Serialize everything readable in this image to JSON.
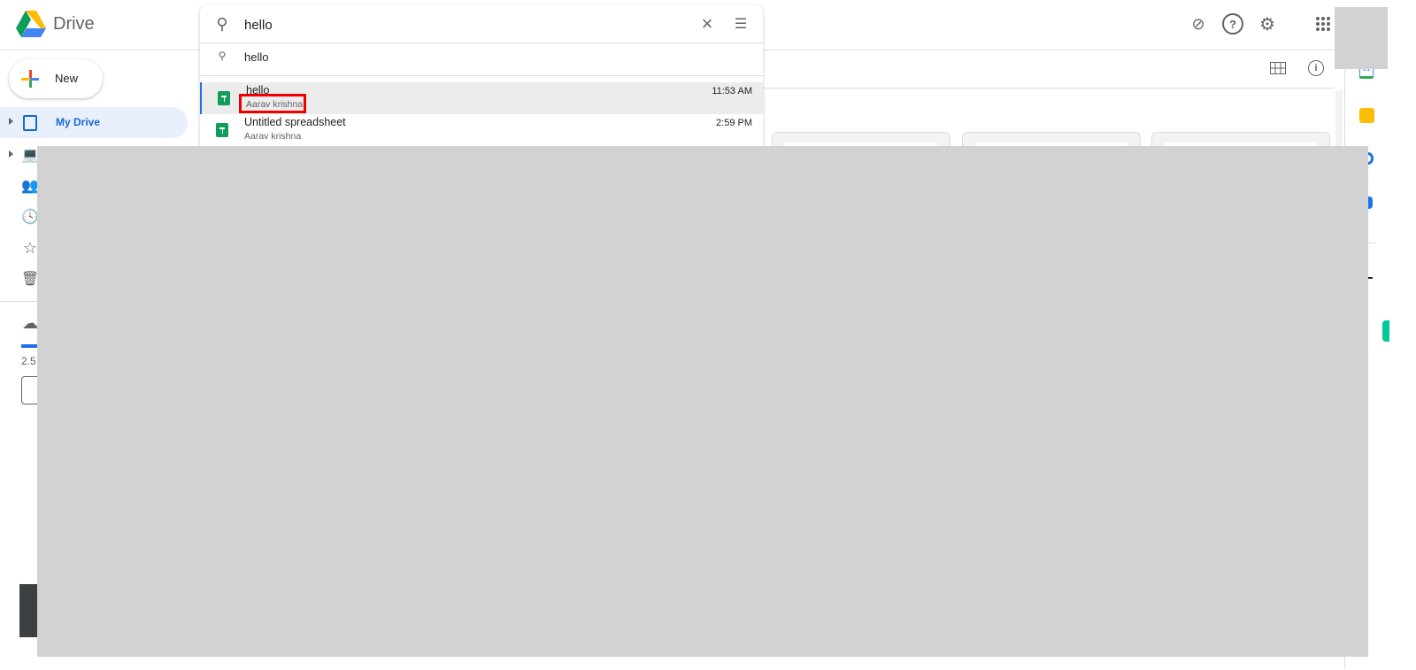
{
  "app": {
    "title": "Drive"
  },
  "sidebar": {
    "new_label": "New",
    "items": [
      {
        "label": "My Drive",
        "active": true
      }
    ],
    "storage_text": "2.5"
  },
  "search": {
    "value": "hello",
    "suggestion": "hello",
    "results": [
      {
        "name": "hello",
        "owner": "Aarav krishna",
        "time": "11:53 AM",
        "type": "spreadsheet",
        "selected": true
      },
      {
        "name": "Untitled spreadsheet",
        "owner": "Aarav krishna",
        "time": "2:59 PM",
        "type": "spreadsheet",
        "selected": false
      }
    ]
  },
  "colors": {
    "accent": "#1967d2",
    "highlight_box": "#e00000",
    "sheets": "#0f9d58"
  }
}
